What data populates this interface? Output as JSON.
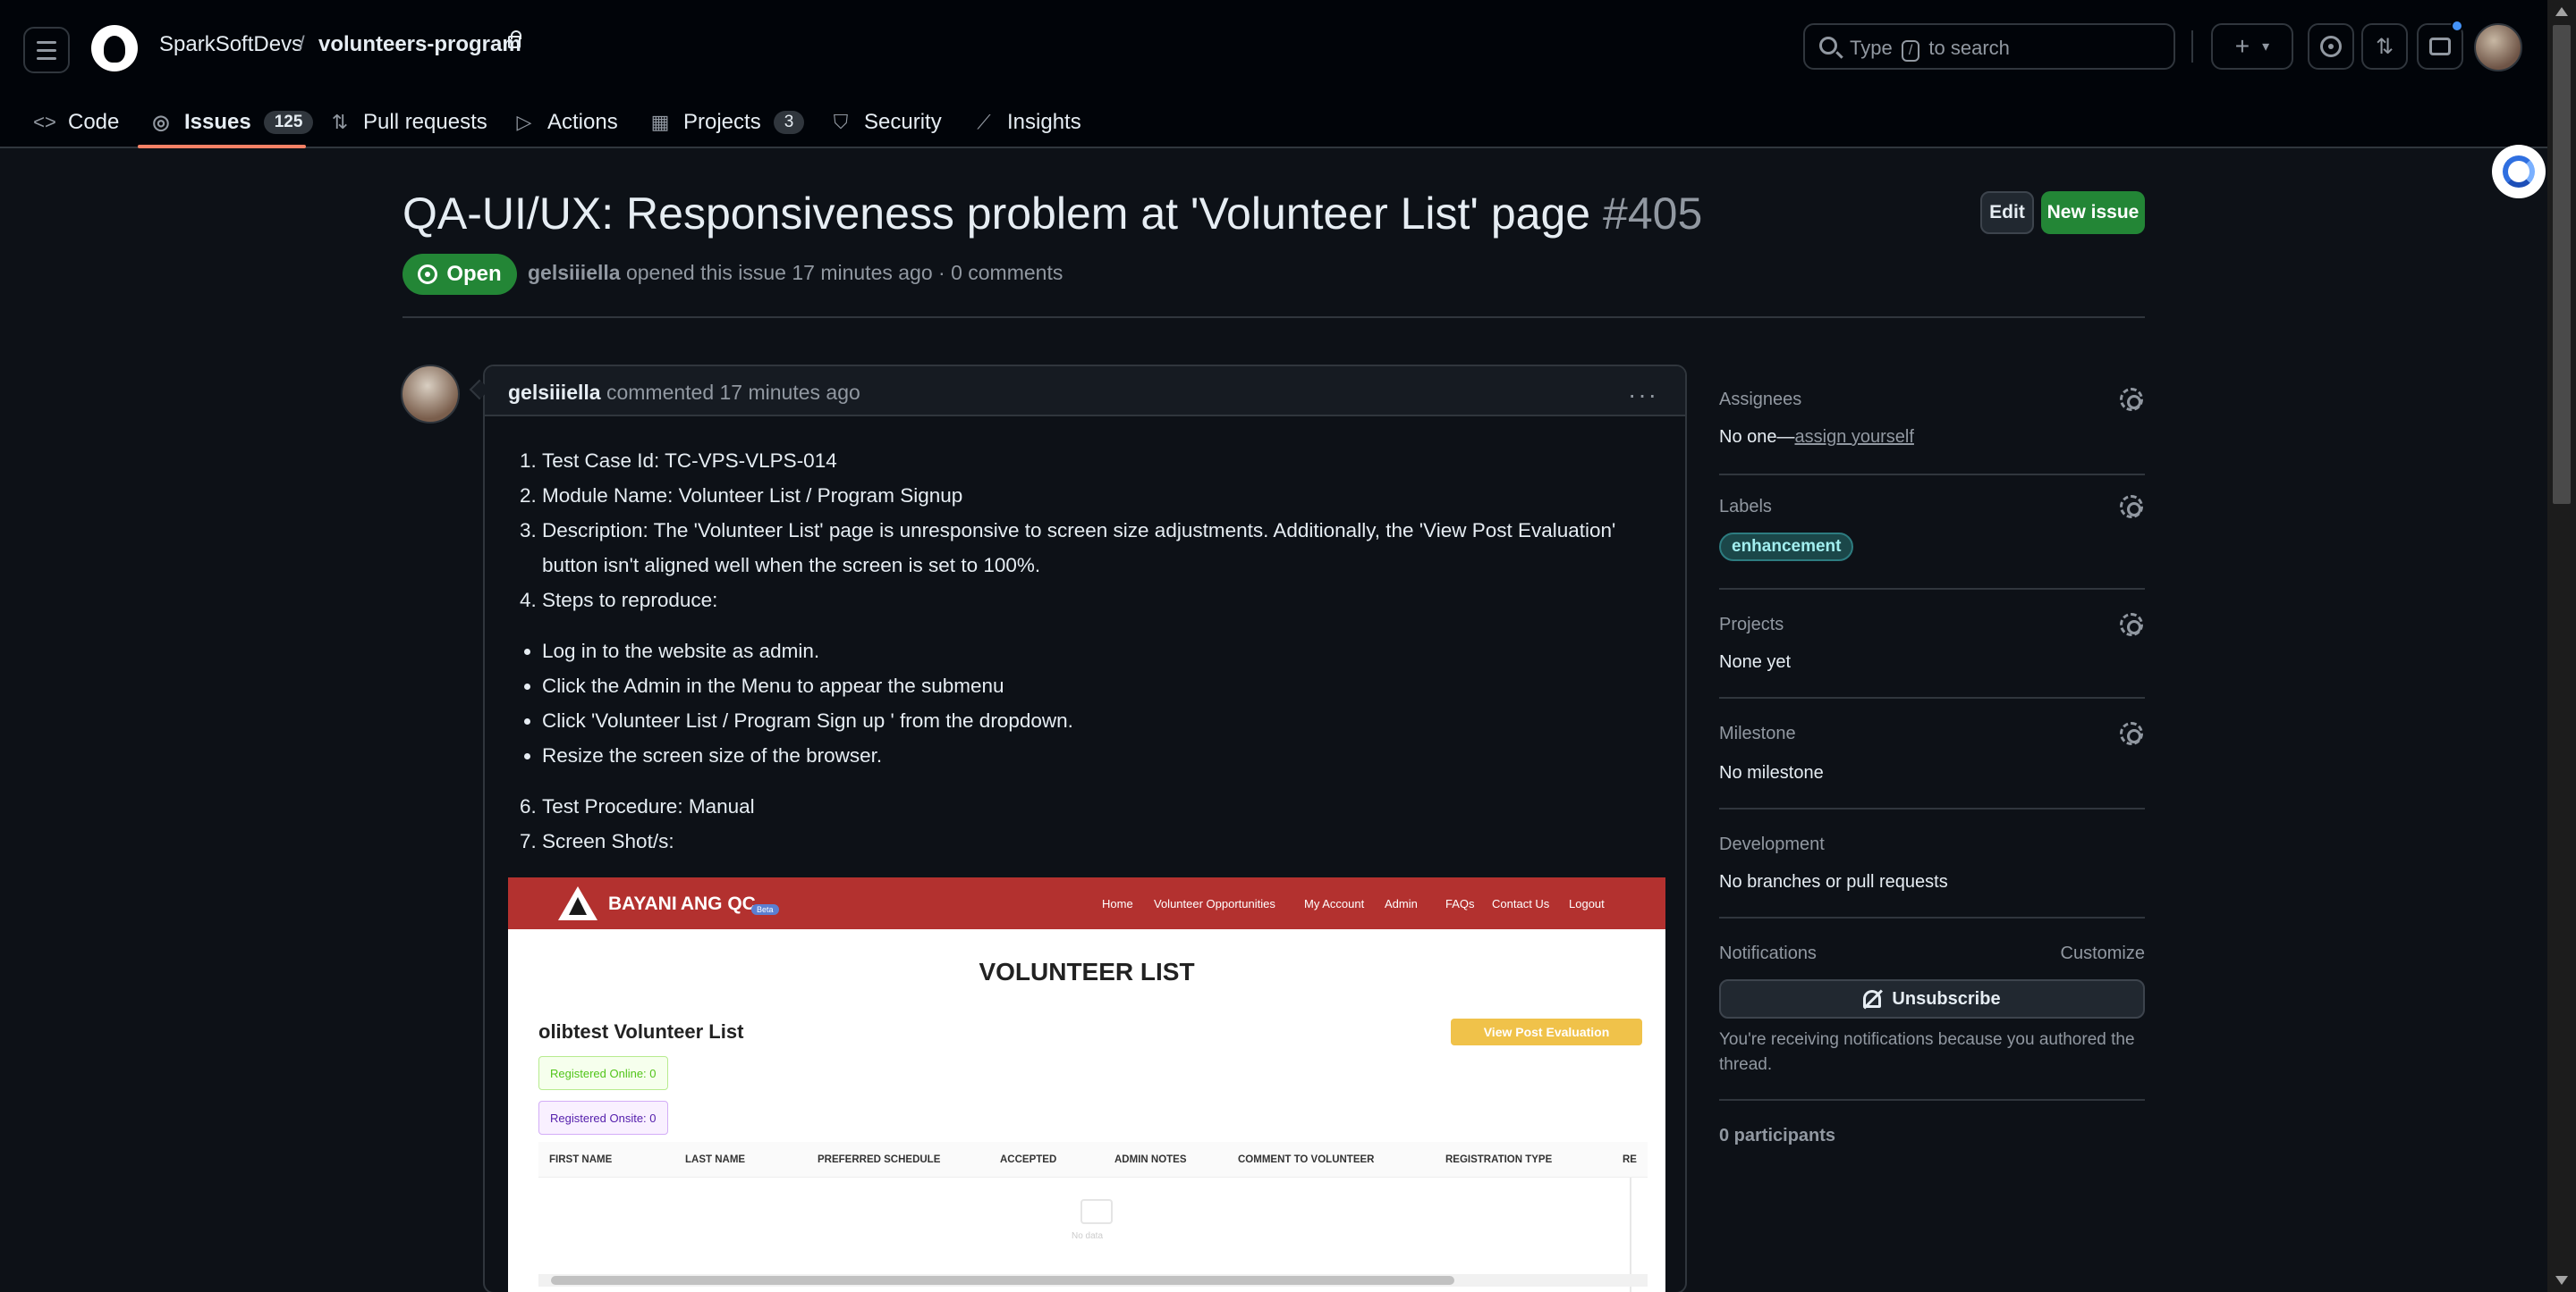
{
  "header": {
    "owner": "SparkSoftDevs",
    "separator": "/",
    "repo": "volunteers-program",
    "search_placeholder_before": "Type",
    "search_key": "/",
    "search_placeholder_after": "to search",
    "plus_icon": "+",
    "caret_icon": "▾",
    "pr_icon": "⇅"
  },
  "tabs": [
    {
      "label": "Code",
      "icon": "code-icon"
    },
    {
      "label": "Issues",
      "count": "125",
      "icon": "issue-icon",
      "active": true
    },
    {
      "label": "Pull requests",
      "icon": "pull-request-icon"
    },
    {
      "label": "Actions",
      "icon": "play-icon"
    },
    {
      "label": "Projects",
      "count": "3",
      "icon": "table-icon"
    },
    {
      "label": "Security",
      "icon": "shield-icon"
    },
    {
      "label": "Insights",
      "icon": "graph-icon"
    }
  ],
  "issue": {
    "title": "QA-UI/UX: Responsiveness problem at 'Volunteer List' page",
    "number": "#405",
    "state": "Open",
    "author": "gelsiiiella",
    "meta": "opened this issue 17 minutes ago · 0 comments",
    "edit_label": "Edit",
    "new_issue_label": "New issue"
  },
  "comment": {
    "author": "gelsiiiella",
    "action": "commented 17 minutes ago",
    "kebab": "···",
    "list_a": [
      "Test Case Id: TC-VPS-VLPS-014",
      "Module Name: Volunteer List / Program Signup",
      "Description: The 'Volunteer List' page is unresponsive to screen size adjustments. Additionally, the 'View Post Evaluation' button isn't aligned well when the screen is set to 100%.",
      "Steps to reproduce:"
    ],
    "steps": [
      "Log in to the website as admin.",
      "Click the Admin in the Menu to appear the submenu",
      "Click 'Volunteer List / Program Sign up ' from the dropdown.",
      "Resize the screen size of the browser."
    ],
    "list_b": [
      "Test Procedure: Manual",
      "Screen Shot/s:"
    ]
  },
  "screenshot": {
    "logo": "BAYANI ANG QC",
    "beta": "Beta",
    "menu": [
      "Home",
      "Volunteer Opportunities",
      "My Account",
      "Admin",
      "FAQs",
      "Contact Us",
      "Logout"
    ],
    "page_title": "VOLUNTEER LIST",
    "list_title": "olibtest Volunteer List",
    "view_post_eval": "View Post Evaluation",
    "registered_online": "Registered Online:  0",
    "registered_onsite": "Registered Onsite: 0",
    "columns": [
      "FIRST NAME",
      "LAST NAME",
      "PREFERRED SCHEDULE",
      "ACCEPTED",
      "ADMIN NOTES",
      "COMMENT TO VOLUNTEER",
      "REGISTRATION TYPE",
      "RE"
    ],
    "empty": "No data"
  },
  "sidebar": {
    "assignees_label": "Assignees",
    "assignees_value": "No one—",
    "assign_yourself": "assign yourself",
    "labels_label": "Labels",
    "label_chip": "enhancement",
    "projects_label": "Projects",
    "projects_value": "None yet",
    "milestone_label": "Milestone",
    "milestone_value": "No milestone",
    "development_label": "Development",
    "development_value": "No branches or pull requests",
    "notifications_label": "Notifications",
    "customize": "Customize",
    "unsubscribe": "Unsubscribe",
    "notif_reason": "You're receiving notifications because you authored the thread.",
    "participants": "0 participants"
  },
  "colors": {
    "accent_green": "#238636",
    "tab_underline": "#f78166",
    "label_bg": "#1b4749",
    "label_text": "#a2eeef"
  }
}
